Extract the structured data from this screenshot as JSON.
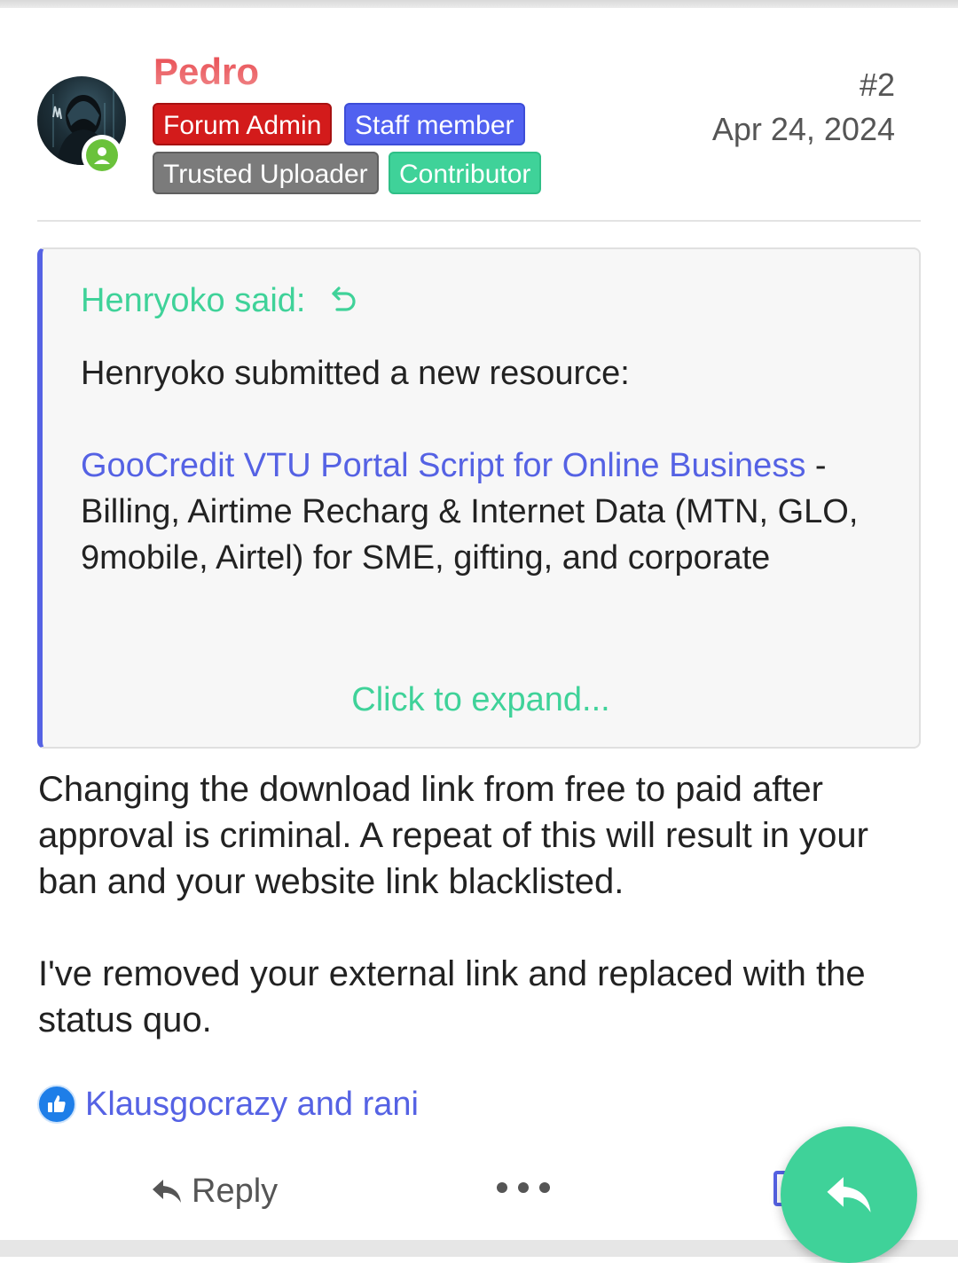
{
  "post": {
    "username": "Pedro",
    "banners": {
      "admin": "Forum Admin",
      "staff": "Staff member",
      "trusted": "Trusted Uploader",
      "contributor": "Contributor"
    },
    "number": "#2",
    "date": "Apr 24, 2024"
  },
  "quote": {
    "author": "Henryoko said:",
    "intro": "Henryoko submitted a new resource:",
    "resource_link": "GooCredit VTU Portal Script for Online Business",
    "resource_desc": " - Billing, Airtime Recharg & Internet Data (MTN, GLO, 9mobile, Airtel) for SME, gifting, and corporate",
    "expand": "Click to expand..."
  },
  "message": {
    "p1": "Changing the download link from free to paid after approval is criminal. A repeat of this will result in your ban and your website link blacklisted.",
    "p2": "I've removed your external link and replaced with the status quo."
  },
  "reactions": {
    "users": "Klausgocrazy and rani"
  },
  "actions": {
    "reply": "Reply"
  },
  "colors": {
    "accent": "#5562e4",
    "green": "#3fd299",
    "admin_red": "#d31b1b",
    "username": "#e8474d"
  },
  "icons": [
    "online-status-icon",
    "quote-jump-icon",
    "like-icon",
    "reply-icon",
    "more-icon",
    "fab-reply-icon"
  ]
}
